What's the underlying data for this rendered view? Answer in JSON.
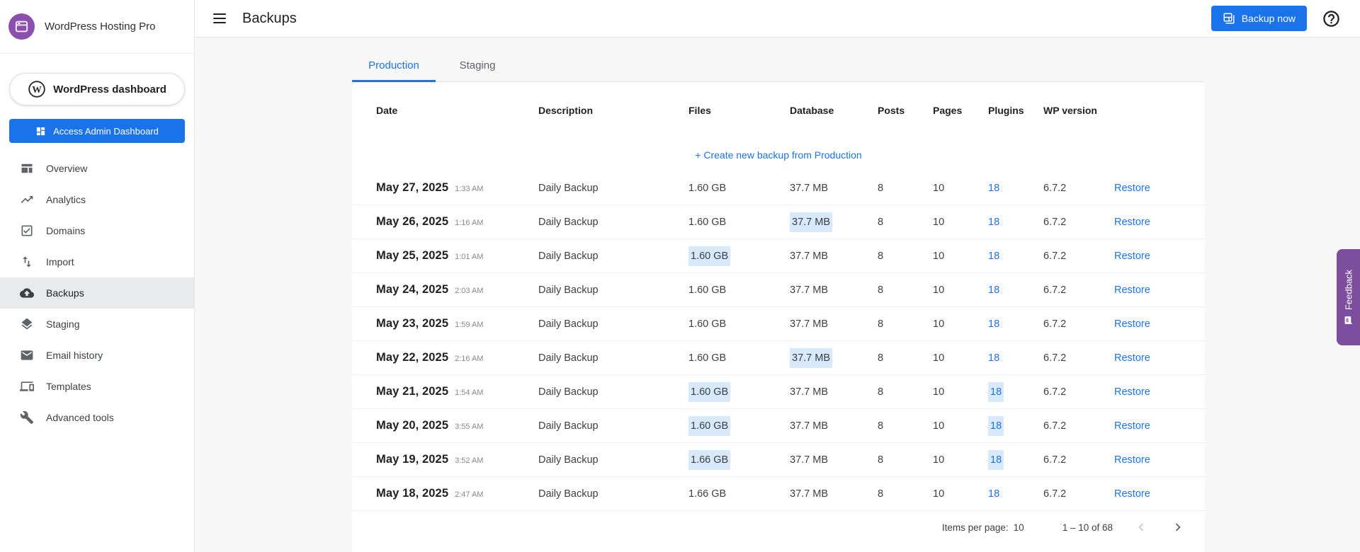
{
  "app": {
    "name": "WordPress Hosting Pro"
  },
  "sidebar": {
    "wordpress_dashboard_label": "WordPress dashboard",
    "admin_dashboard_button": "Access Admin Dashboard",
    "items": [
      {
        "label": "Overview",
        "slug": "overview",
        "icon": "overview-icon",
        "active": false
      },
      {
        "label": "Analytics",
        "slug": "analytics",
        "icon": "analytics-icon",
        "active": false
      },
      {
        "label": "Domains",
        "slug": "domains",
        "icon": "domains-icon",
        "active": false
      },
      {
        "label": "Import",
        "slug": "import",
        "icon": "import-icon",
        "active": false
      },
      {
        "label": "Backups",
        "slug": "backups",
        "icon": "backups-icon",
        "active": true
      },
      {
        "label": "Staging",
        "slug": "staging",
        "icon": "staging-icon",
        "active": false
      },
      {
        "label": "Email history",
        "slug": "email-history",
        "icon": "email-icon",
        "active": false
      },
      {
        "label": "Templates",
        "slug": "templates",
        "icon": "templates-icon",
        "active": false
      },
      {
        "label": "Advanced tools",
        "slug": "advanced-tools",
        "icon": "wrench-icon",
        "active": false
      }
    ]
  },
  "header": {
    "title": "Backups",
    "backup_now_label": "Backup now"
  },
  "tabs": [
    {
      "label": "Production",
      "active": true
    },
    {
      "label": "Staging",
      "active": false
    }
  ],
  "table": {
    "columns": [
      "Date",
      "Description",
      "Files",
      "Database",
      "Posts",
      "Pages",
      "Plugins",
      "WP version"
    ],
    "create_link_label": "+ Create new backup from Production",
    "restore_label": "Restore",
    "rows": [
      {
        "date": "May 27, 2025",
        "time": "1:33 AM",
        "description": "Daily Backup",
        "files": "1.60 GB",
        "database": "37.7 MB",
        "posts": "8",
        "pages": "10",
        "plugins": "18",
        "wp_version": "6.7.2",
        "highlight": []
      },
      {
        "date": "May 26, 2025",
        "time": "1:16 AM",
        "description": "Daily Backup",
        "files": "1.60 GB",
        "database": "37.7 MB",
        "posts": "8",
        "pages": "10",
        "plugins": "18",
        "wp_version": "6.7.2",
        "highlight": [
          "database"
        ]
      },
      {
        "date": "May 25, 2025",
        "time": "1:01 AM",
        "description": "Daily Backup",
        "files": "1.60 GB",
        "database": "37.7 MB",
        "posts": "8",
        "pages": "10",
        "plugins": "18",
        "wp_version": "6.7.2",
        "highlight": [
          "files"
        ]
      },
      {
        "date": "May 24, 2025",
        "time": "2:03 AM",
        "description": "Daily Backup",
        "files": "1.60 GB",
        "database": "37.7 MB",
        "posts": "8",
        "pages": "10",
        "plugins": "18",
        "wp_version": "6.7.2",
        "highlight": []
      },
      {
        "date": "May 23, 2025",
        "time": "1:59 AM",
        "description": "Daily Backup",
        "files": "1.60 GB",
        "database": "37.7 MB",
        "posts": "8",
        "pages": "10",
        "plugins": "18",
        "wp_version": "6.7.2",
        "highlight": []
      },
      {
        "date": "May 22, 2025",
        "time": "2:16 AM",
        "description": "Daily Backup",
        "files": "1.60 GB",
        "database": "37.7 MB",
        "posts": "8",
        "pages": "10",
        "plugins": "18",
        "wp_version": "6.7.2",
        "highlight": [
          "database"
        ]
      },
      {
        "date": "May 21, 2025",
        "time": "1:54 AM",
        "description": "Daily Backup",
        "files": "1.60 GB",
        "database": "37.7 MB",
        "posts": "8",
        "pages": "10",
        "plugins": "18",
        "wp_version": "6.7.2",
        "highlight": [
          "files",
          "plugins"
        ]
      },
      {
        "date": "May 20, 2025",
        "time": "3:55 AM",
        "description": "Daily Backup",
        "files": "1.60 GB",
        "database": "37.7 MB",
        "posts": "8",
        "pages": "10",
        "plugins": "18",
        "wp_version": "6.7.2",
        "highlight": [
          "files",
          "plugins"
        ]
      },
      {
        "date": "May 19, 2025",
        "time": "3:52 AM",
        "description": "Daily Backup",
        "files": "1.66 GB",
        "database": "37.7 MB",
        "posts": "8",
        "pages": "10",
        "plugins": "18",
        "wp_version": "6.7.2",
        "highlight": [
          "files",
          "plugins"
        ]
      },
      {
        "date": "May 18, 2025",
        "time": "2:47 AM",
        "description": "Daily Backup",
        "files": "1.66 GB",
        "database": "37.7 MB",
        "posts": "8",
        "pages": "10",
        "plugins": "18",
        "wp_version": "6.7.2",
        "highlight": []
      }
    ]
  },
  "pagination": {
    "items_per_page_label": "Items per page:",
    "items_per_page_value": "10",
    "range_label": "1 – 10 of 68"
  },
  "feedback_label": "Feedback",
  "colors": {
    "primary": "#1a73e8",
    "selection_highlight": "#d7e9fb",
    "feedback_purple": "#7d4e9e",
    "logo_purple": "#8d4fae"
  }
}
